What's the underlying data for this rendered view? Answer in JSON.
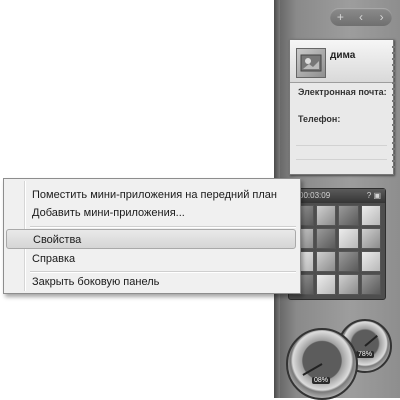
{
  "sidebar": {
    "controls": [
      "+",
      "‹",
      "›"
    ],
    "contact": {
      "name": "дима",
      "email_label": "Электронная почта:",
      "phone_label": "Телефон:"
    },
    "puzzle": {
      "timer": "00:03:09",
      "icons": "? ▣"
    },
    "meter": {
      "cpu": "08%",
      "mem": "78%"
    }
  },
  "context_menu": {
    "items": [
      "Поместить мини-приложения на передний план",
      "Добавить мини-приложения...",
      "Свойства",
      "Справка",
      "Закрыть боковую панель"
    ],
    "highlighted_index": 2
  }
}
